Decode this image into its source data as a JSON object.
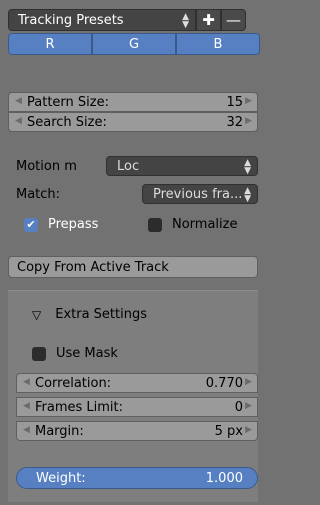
{
  "presets": {
    "label": "Tracking Presets",
    "add_icon": "plus-icon",
    "remove_icon": "minus-icon"
  },
  "channels": [
    "R",
    "G",
    "B"
  ],
  "pattern_size": {
    "label": "Pattern Size:",
    "value": "15"
  },
  "search_size": {
    "label": "Search Size:",
    "value": "32"
  },
  "motion_model": {
    "label": "Motion m",
    "value": "Loc"
  },
  "match": {
    "label": "Match:",
    "value": "Previous fra..."
  },
  "prepass": {
    "label": "Prepass",
    "checked": true
  },
  "normalize": {
    "label": "Normalize",
    "checked": false
  },
  "copy_button": "Copy From Active Track",
  "extra": {
    "title": "Extra Settings",
    "use_mask": {
      "label": "Use Mask",
      "checked": false
    },
    "correlation": {
      "label": "Correlation:",
      "value": "0.770"
    },
    "frames_limit": {
      "label": "Frames Limit:",
      "value": "0"
    },
    "margin": {
      "label": "Margin:",
      "value": "5 px"
    },
    "weight": {
      "label": "Weight:",
      "value": "1.000"
    }
  },
  "colors": {
    "accent": "#5680c2",
    "panel": "#727272",
    "field": "#9a9a9a",
    "dark": "#444444"
  }
}
